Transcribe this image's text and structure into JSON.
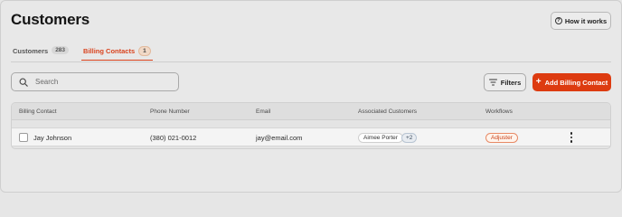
{
  "header": {
    "title": "Customers",
    "how_it_works_label": "How it works",
    "how_it_works_icon": "question-circle-icon"
  },
  "tabs": [
    {
      "label": "Customers",
      "count": "283",
      "active": false
    },
    {
      "label": "Billing Contacts",
      "count": "1",
      "active": true
    }
  ],
  "toolbar": {
    "search_placeholder": "Search",
    "search_value": "",
    "filters_label": "Filters",
    "add_label": "Add Billing Contact",
    "add_icon": "plus-icon",
    "accent_color": "#dd3b10"
  },
  "table": {
    "columns": [
      "Billing Contact",
      "Phone Number",
      "Email",
      "Associated Customers",
      "Workflows"
    ],
    "rows": [
      {
        "billing_contact": "Jay Johnson",
        "phone": "(380) 021-0012",
        "email": "jay@email.com",
        "associated_customer": "Aimee Porter",
        "associated_more": "+2",
        "workflow": "Adjuster"
      }
    ]
  }
}
